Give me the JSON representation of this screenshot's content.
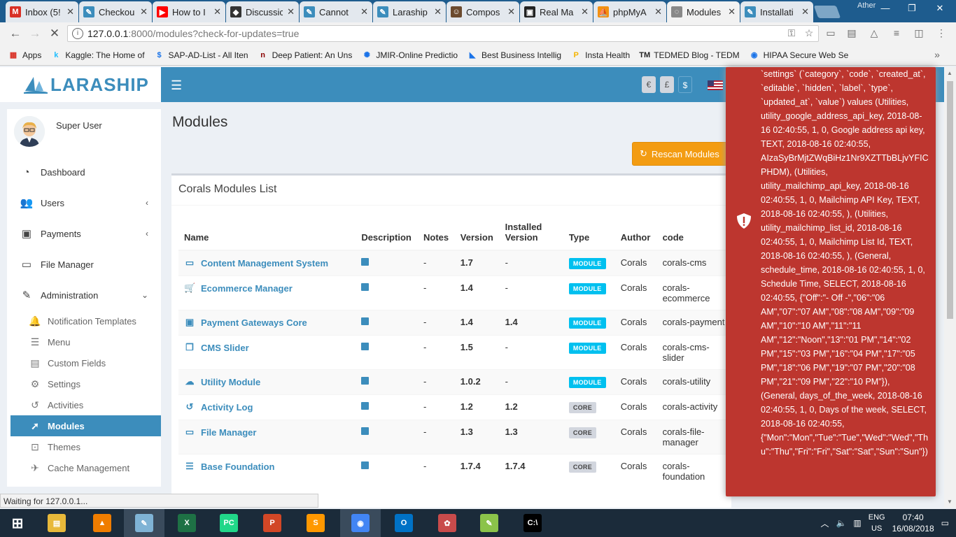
{
  "browser": {
    "tabs": [
      {
        "title": "Inbox (5!",
        "icon": "gmail-icon",
        "color": "#d93025",
        "glyph": "M"
      },
      {
        "title": "Checkou",
        "icon": "bird-icon",
        "color": "#3c8dbc",
        "glyph": "✎"
      },
      {
        "title": "How to I",
        "icon": "youtube-icon",
        "color": "#ff0000",
        "glyph": "▶"
      },
      {
        "title": "Discussic",
        "icon": "discussion-icon",
        "color": "#333333",
        "glyph": "◆"
      },
      {
        "title": "Cannot",
        "icon": "bird-icon",
        "color": "#3c8dbc",
        "glyph": "✎"
      },
      {
        "title": "Laraship",
        "icon": "bird-icon",
        "color": "#3c8dbc",
        "glyph": "✎"
      },
      {
        "title": "Compos",
        "icon": "composer-icon",
        "color": "#6b4a2e",
        "glyph": "☺"
      },
      {
        "title": "Real Ma",
        "icon": "window-icon",
        "color": "#222222",
        "glyph": "▣"
      },
      {
        "title": "phpMyA",
        "icon": "phpmyadmin-icon",
        "color": "#f29111",
        "glyph": "⛵"
      },
      {
        "title": "Modules",
        "icon": "loading-icon",
        "color": "#888888",
        "glyph": "◌"
      },
      {
        "title": "Installati",
        "icon": "bird-icon",
        "color": "#3c8dbc",
        "glyph": "✎"
      }
    ],
    "profile_name": "Ather",
    "url_host": "127.0.0.1",
    "url_rest": ":8000/modules?check-for-updates=true",
    "bookmarks": [
      {
        "label": "Apps",
        "glyph": "▦",
        "color": "#d93025"
      },
      {
        "label": "Kaggle: The Home of",
        "glyph": "k",
        "color": "#20beff"
      },
      {
        "label": "SAP-AD-List - All Iten",
        "glyph": "$",
        "color": "#1a73e8"
      },
      {
        "label": "Deep Patient: An Uns",
        "glyph": "n",
        "color": "#8b0000"
      },
      {
        "label": "JMIR-Online Predictio",
        "glyph": "✺",
        "color": "#1a73e8"
      },
      {
        "label": "Best Business Intellig",
        "glyph": "◣",
        "color": "#1a73e8"
      },
      {
        "label": "Insta Health",
        "glyph": "P",
        "color": "#f4b400"
      },
      {
        "label": "TEDMED Blog - TEDM",
        "glyph": "TM",
        "color": "#222222"
      },
      {
        "label": "HIPAA Secure Web Se",
        "glyph": "◉",
        "color": "#1a73e8"
      }
    ],
    "status_text": "Waiting for 127.0.0.1..."
  },
  "app": {
    "logo": "LARASHIP",
    "currencies": [
      "€",
      "£",
      "$"
    ],
    "user": "Super User",
    "menu": [
      {
        "label": "Dashboard",
        "icon": "dashboard-icon",
        "glyph": "◔",
        "chevron": ""
      },
      {
        "label": "Users",
        "icon": "users-icon",
        "glyph": "👥",
        "chevron": "‹"
      },
      {
        "label": "Payments",
        "icon": "payments-icon",
        "glyph": "▣",
        "chevron": "‹"
      },
      {
        "label": "File Manager",
        "icon": "folder-icon",
        "glyph": "▭",
        "chevron": ""
      },
      {
        "label": "Administration",
        "icon": "wrench-icon",
        "glyph": "✎",
        "chevron": "⌄"
      }
    ],
    "submenu": [
      {
        "label": "Notification Templates",
        "icon": "bell-icon",
        "glyph": "🔔"
      },
      {
        "label": "Menu",
        "icon": "bars-icon",
        "glyph": "☰"
      },
      {
        "label": "Custom Fields",
        "icon": "file-icon",
        "glyph": "▤"
      },
      {
        "label": "Settings",
        "icon": "gears-icon",
        "glyph": "⚙"
      },
      {
        "label": "Activities",
        "icon": "history-icon",
        "glyph": "↺"
      },
      {
        "label": "Modules",
        "icon": "rocket-icon",
        "glyph": "➚",
        "active": true
      },
      {
        "label": "Themes",
        "icon": "themes-icon",
        "glyph": "⊡"
      },
      {
        "label": "Cache Management",
        "icon": "plane-icon",
        "glyph": "✈"
      }
    ],
    "page_title": "Modules",
    "rescan_label": "Rescan Modules",
    "box_title": "Corals Modules List",
    "table": {
      "headers": [
        "Name",
        "Description",
        "Notes",
        "Version",
        "Installed Version",
        "Type",
        "Author",
        "code"
      ],
      "rows": [
        {
          "name": "Content Management System",
          "icon": "desktop-icon",
          "glyph": "▭",
          "notes": "-",
          "version": "1.7",
          "installed": "-",
          "type": "MODULE",
          "author": "Corals",
          "code": "corals-cms"
        },
        {
          "name": "Ecommerce Manager",
          "icon": "cart-icon",
          "glyph": "🛒",
          "notes": "-",
          "version": "1.4",
          "installed": "-",
          "type": "MODULE",
          "author": "Corals",
          "code": "corals-ecommerce"
        },
        {
          "name": "Payment Gateways Core",
          "icon": "money-icon",
          "glyph": "▣",
          "notes": "-",
          "version": "1.4",
          "installed": "1.4",
          "type": "MODULE",
          "author": "Corals",
          "code": "corals-payment"
        },
        {
          "name": "CMS Slider",
          "icon": "clone-icon",
          "glyph": "❐",
          "notes": "-",
          "version": "1.5",
          "installed": "-",
          "type": "MODULE",
          "author": "Corals",
          "code": "corals-cms-slider"
        },
        {
          "name": "Utility Module",
          "icon": "cloud-icon",
          "glyph": "☁",
          "notes": "-",
          "version": "1.0.2",
          "installed": "-",
          "type": "MODULE",
          "author": "Corals",
          "code": "corals-utility"
        },
        {
          "name": "Activity Log",
          "icon": "history-icon",
          "glyph": "↺",
          "notes": "-",
          "version": "1.2",
          "installed": "1.2",
          "type": "CORE",
          "author": "Corals",
          "code": "corals-activity"
        },
        {
          "name": "File Manager",
          "icon": "folder-icon",
          "glyph": "▭",
          "notes": "-",
          "version": "1.3",
          "installed": "1.3",
          "type": "CORE",
          "author": "Corals",
          "code": "corals-file-manager"
        },
        {
          "name": "Base Foundation",
          "icon": "bars-icon",
          "glyph": "☰",
          "notes": "-",
          "version": "1.7.4",
          "installed": "1.7.4",
          "type": "CORE",
          "author": "Corals",
          "code": "corals-foundation"
        }
      ]
    },
    "error_message": "`settings` (`category`, `code`, `created_at`, `editable`, `hidden`, `label`, `type`, `updated_at`, `value`) values (Utilities, utility_google_address_api_key, 2018-08-16 02:40:55, 1, 0, Google address api key, TEXT, 2018-08-16 02:40:55, AIzaSyBrMjtZWqBiHz1Nr9XZTTbBLjvYFICPHDM), (Utilities, utility_mailchimp_api_key, 2018-08-16 02:40:55, 1, 0, Mailchimp API Key, TEXT, 2018-08-16 02:40:55, ), (Utilities, utility_mailchimp_list_id, 2018-08-16 02:40:55, 1, 0, Mailchimp List Id, TEXT, 2018-08-16 02:40:55, ), (General, schedule_time, 2018-08-16 02:40:55, 1, 0, Schedule Time, SELECT, 2018-08-16 02:40:55, {\"Off\":\"- Off -\",\"06\":\"06 AM\",\"07\":\"07 AM\",\"08\":\"08 AM\",\"09\":\"09 AM\",\"10\":\"10 AM\",\"11\":\"11 AM\",\"12\":\"Noon\",\"13\":\"01 PM\",\"14\":\"02 PM\",\"15\":\"03 PM\",\"16\":\"04 PM\",\"17\":\"05 PM\",\"18\":\"06 PM\",\"19\":\"07 PM\",\"20\":\"08 PM\",\"21\":\"09 PM\",\"22\":\"10 PM\"}), (General, days_of_the_week, 2018-08-16 02:40:55, 1, 0, Days of the week, SELECT, 2018-08-16 02:40:55, {\"Mon\":\"Mon\",\"Tue\":\"Tue\",\"Wed\":\"Wed\",\"Thu\":\"Thu\",\"Fri\":\"Fri\",\"Sat\":\"Sat\",\"Sun\":\"Sun\"})"
  },
  "taskbar": {
    "apps": [
      {
        "name": "windows-start-icon",
        "glyph": "⊞",
        "color": "#1b2b3a"
      },
      {
        "name": "file-explorer-icon",
        "glyph": "▤",
        "color": "#e8b93a"
      },
      {
        "name": "vlc-icon",
        "glyph": "▲",
        "color": "#f07d00"
      },
      {
        "name": "notepad-icon",
        "glyph": "✎",
        "color": "#7fb3d5",
        "open": true
      },
      {
        "name": "excel-icon",
        "glyph": "X",
        "color": "#1e7145"
      },
      {
        "name": "pycharm-icon",
        "glyph": "PC",
        "color": "#21d789"
      },
      {
        "name": "powerpoint-icon",
        "glyph": "P",
        "color": "#d24726"
      },
      {
        "name": "sublime-icon",
        "glyph": "S",
        "color": "#ff9800"
      },
      {
        "name": "chrome-icon",
        "glyph": "◉",
        "color": "#4285f4",
        "open": true
      },
      {
        "name": "outlook-icon",
        "glyph": "O",
        "color": "#0072c6"
      },
      {
        "name": "paint-icon",
        "glyph": "✿",
        "color": "#c94b4b"
      },
      {
        "name": "notepadpp-icon",
        "glyph": "✎",
        "color": "#8bc34a"
      },
      {
        "name": "cmd-icon",
        "glyph": "C:\\",
        "color": "#000000"
      }
    ],
    "lang_top": "ENG",
    "lang_bottom": "US",
    "time": "07:40",
    "date": "16/08/2018"
  }
}
